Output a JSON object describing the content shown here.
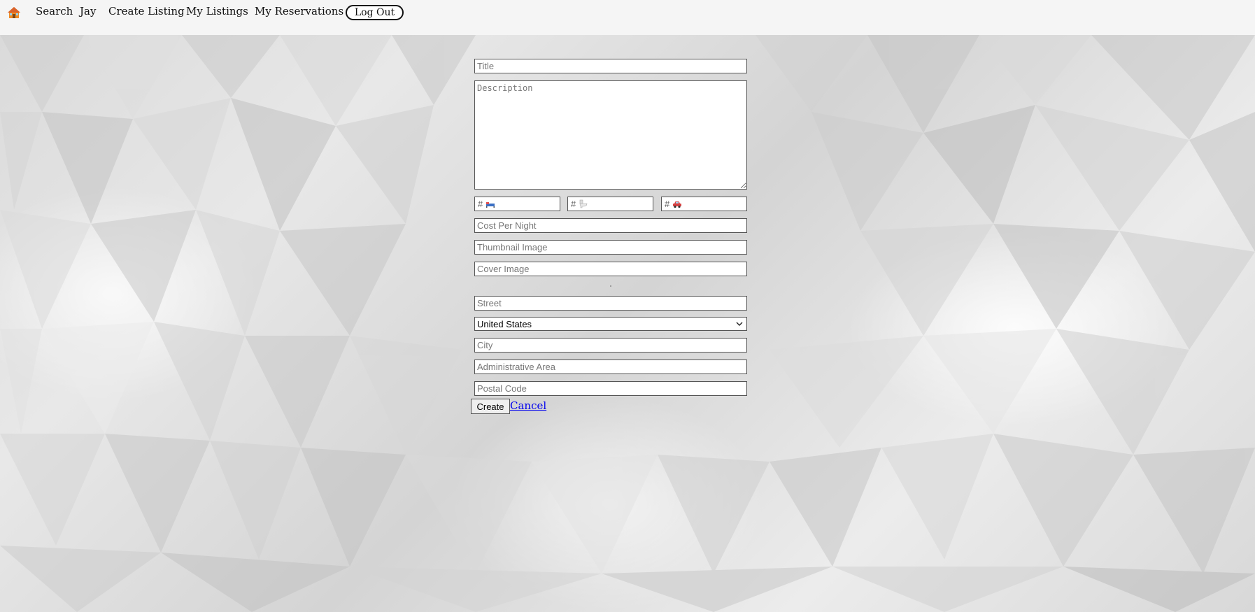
{
  "navbar": {
    "home_icon": "house-icon",
    "links": [
      "Search",
      "Jay",
      "Create Listing",
      "My Listings",
      "My Reservations"
    ],
    "logout_label": "Log Out"
  },
  "form": {
    "title_placeholder": "Title",
    "description_placeholder": "Description",
    "bedrooms": {
      "prefix": "#",
      "icon": "bed-icon"
    },
    "bathrooms": {
      "prefix": "#",
      "icon": "toilet-icon"
    },
    "parking": {
      "prefix": "#",
      "icon": "car-icon"
    },
    "cost_placeholder": "Cost Per Night",
    "thumbnail_placeholder": "Thumbnail Image",
    "cover_placeholder": "Cover Image",
    "street_placeholder": "Street",
    "country_value": "United States",
    "city_placeholder": "City",
    "admin_area_placeholder": "Administrative Area",
    "postal_placeholder": "Postal Code",
    "create_label": "Create",
    "cancel_label": "Cancel"
  }
}
